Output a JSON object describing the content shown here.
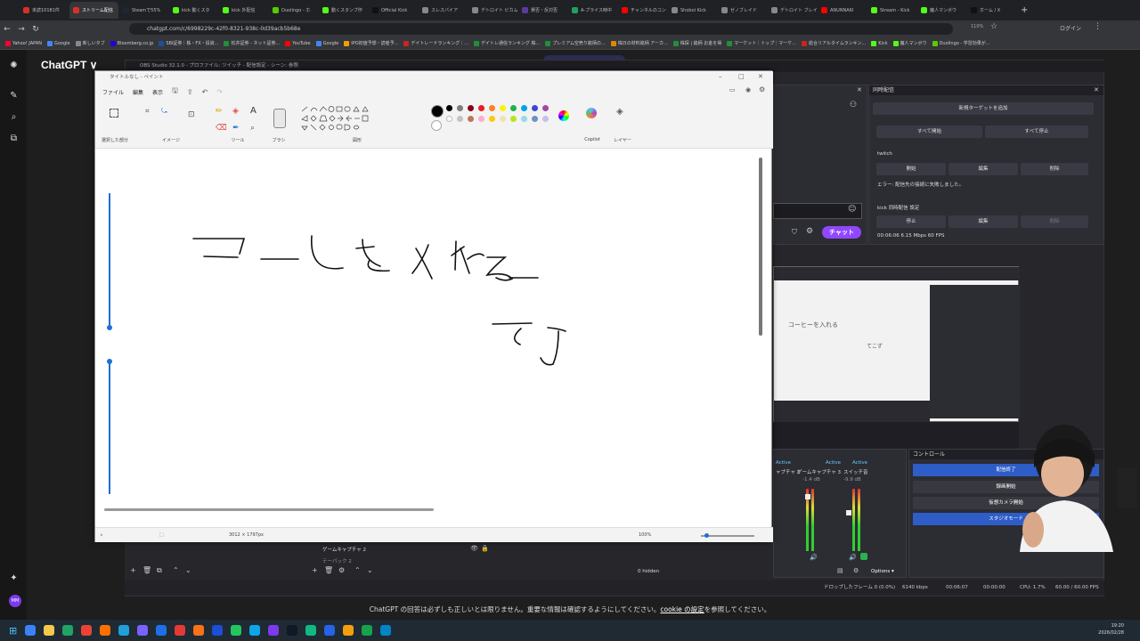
{
  "browser": {
    "tabs": [
      {
        "label": "未読10181件",
        "color": "#d93025"
      },
      {
        "label": "ストリーム配信",
        "color": "#d93025",
        "active": true
      },
      {
        "label": "Steamで55%",
        "color": "#1b2838"
      },
      {
        "label": "kick 動くスタ",
        "color": "#53fc18"
      },
      {
        "label": "kick 外配信",
        "color": "#53fc18"
      },
      {
        "label": "Duolingo - ホ",
        "color": "#58cc02"
      },
      {
        "label": "動くスタンプ作",
        "color": "#53fc18"
      },
      {
        "label": "Official Kick",
        "color": "#111111"
      },
      {
        "label": "スレスパイア",
        "color": "#888888"
      },
      {
        "label": "デトロイト ビカム",
        "color": "#888888"
      },
      {
        "label": "賛否・反対否",
        "color": "#5b3a9e"
      },
      {
        "label": "A-プライス時中",
        "color": "#20a060"
      },
      {
        "label": "チャンネルのコン",
        "color": "#ff0000"
      },
      {
        "label": "Shoboi Kick",
        "color": "#888888"
      },
      {
        "label": "ゼノブレイド",
        "color": "#888888"
      },
      {
        "label": "デトロイト ブレイ",
        "color": "#888888"
      },
      {
        "label": "ANUNNAKI",
        "color": "#ff0000"
      },
      {
        "label": "Stream - Kick",
        "color": "#53fc18"
      },
      {
        "label": "魔人マンボウ",
        "color": "#53fc18"
      },
      {
        "label": "ホーム / X",
        "color": "#111111"
      }
    ],
    "new_tab": "+",
    "url": "chatgpt.com/c/6998229c-42f0-8321-938c-0d39acb5b68e",
    "zoom": "110%",
    "login_label": "ログイン",
    "bookmarks": [
      {
        "label": "Yahoo! JAPAN",
        "color": "#ff0033"
      },
      {
        "label": "Google",
        "color": "#4285f4"
      },
      {
        "label": "新しいタブ",
        "color": "#888888"
      },
      {
        "label": "Bloomberg.co.jp",
        "color": "#2800d7"
      },
      {
        "label": "SBI証券｜株・FX・投資...",
        "color": "#1f4e9c"
      },
      {
        "label": "松井証券 - ネット証券...",
        "color": "#1f8f3a"
      },
      {
        "label": "YouTube",
        "color": "#ff0000"
      },
      {
        "label": "Google",
        "color": "#4285f4"
      },
      {
        "label": "IPO初値予想・読者予...",
        "color": "#f0a000"
      },
      {
        "label": "デイトレードランキング｜...",
        "color": "#cc2222"
      },
      {
        "label": "デイトレ通信ランキング 株...",
        "color": "#1f8f3a"
      },
      {
        "label": "プレミアム空売り銘柄の...",
        "color": "#1f8f3a"
      },
      {
        "label": "株日の材料銘柄 アーカ...",
        "color": "#dd8800"
      },
      {
        "label": "株探 | 銘柄 お金を得",
        "color": "#1f8f3a"
      },
      {
        "label": "マーケット｜トップ｜マーケ...",
        "color": "#1f8f3a"
      },
      {
        "label": "総合リアルタイムランキン...",
        "color": "#cc2222"
      },
      {
        "label": "Kick",
        "color": "#53fc18"
      },
      {
        "label": "魔人マンボウ",
        "color": "#53fc18"
      },
      {
        "label": "Duolingo - 学習効果が...",
        "color": "#58cc02"
      }
    ]
  },
  "chatgpt": {
    "title": "ChatGPT ∨",
    "disclaimer": "ChatGPT の回答は必ずしも正しいとは限りません。重要な情報は確認するようにしてください。",
    "cookie_link": "cookie の設定",
    "disclaimer_tail": "を参照してください。",
    "avatar": "MM"
  },
  "obs": {
    "title": "OBS Studio 32.1.0 - プロファイル: ツイッチ - 配信設定 - シーン: 参照",
    "multistream": {
      "title": "同時配信",
      "add_target": "新規ターゲットを追加",
      "start_all": "すべて開始",
      "stop_all": "すべて停止",
      "twitch_label": "twitch",
      "start": "開始",
      "edit": "編集",
      "delete": "削除",
      "error": "エラー: 配信先の接続に失敗しました。",
      "kick_label": "kick 同時配信 設定",
      "stop": "停止",
      "stats": "00:06:06  6.15 Mbps  60 FPS"
    },
    "chat_button": "チャット",
    "controls": {
      "title": "コントロール",
      "buttons": [
        "配信終了",
        "録画開始",
        "仮想カメラ開始",
        "スタジオモード"
      ]
    },
    "audio": {
      "labels": [
        "Active",
        "Active",
        "Active"
      ],
      "channels": [
        "ャプチャ 2",
        "ゲームキャプチャ 3",
        "スイッチ音"
      ],
      "db": [
        "-1.4 dB",
        "-9.9 dB"
      ],
      "hidden": "0 hidden",
      "options": "Options ▾"
    },
    "sources": [
      "ゲームキャプチャ 2",
      "テーパック 2"
    ],
    "status": {
      "dropped": "ドロップしたフレーム 0 (0.0%)",
      "bitrate": "6140 kbps",
      "live_time": "00:06:07",
      "rec_time": "00:00:00",
      "cpu": "CPU: 1.7%",
      "fps": "60.00 / 60.00 FPS"
    }
  },
  "paint": {
    "title": "タイトルなし - ペイント",
    "menu": [
      "ファイル",
      "編集",
      "表示"
    ],
    "groups": [
      "選択した部分",
      "イメージ",
      "ツール",
      "ブラシ",
      "図形",
      "Copilot",
      "レイヤー"
    ],
    "canvas_size": "3012 × 1797px",
    "zoom": "100%",
    "handwriting_line1": "コーヒーを入れる",
    "handwriting_line2": "てこず",
    "palette": [
      "#000000",
      "#7f7f7f",
      "#880015",
      "#ed1c24",
      "#ff7f27",
      "#fff200",
      "#22b14c",
      "#00a2e8",
      "#3f48cc",
      "#a349a4",
      "#ffffff",
      "#c3c3c3",
      "#b97a57",
      "#ffaec9",
      "#ffc90e",
      "#efe4b0",
      "#b5e61d",
      "#99d9ea",
      "#7092be",
      "#c8bfe7"
    ]
  },
  "taskbar": {
    "time": "19:20",
    "date": "2026/02/28",
    "apps": [
      "#3b82f6",
      "#f6c84c",
      "#1fa463",
      "#ea4335",
      "#ff6f00",
      "#1fa0d8",
      "#7b61ff",
      "#1f6feb",
      "#e53935",
      "#f97316",
      "#1d4ed8",
      "#22c55e",
      "#0ea5e9",
      "#7c3aed",
      "#111827",
      "#10b981",
      "#2563eb",
      "#f59e0b",
      "#16a34a",
      "#0284c7"
    ]
  }
}
